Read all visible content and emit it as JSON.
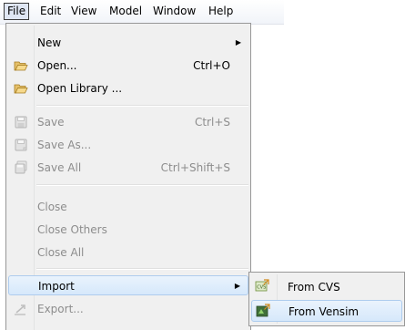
{
  "menubar": {
    "items": [
      "File",
      "Edit",
      "View",
      "Model",
      "Window",
      "Help"
    ]
  },
  "file_menu": {
    "new": {
      "label": "New"
    },
    "open": {
      "label": "Open...",
      "accel": "Ctrl+O",
      "icon": "open-folder-icon"
    },
    "open_library": {
      "label": "Open Library ...",
      "icon": "open-folder-icon"
    },
    "save": {
      "label": "Save",
      "accel": "Ctrl+S",
      "icon": "save-icon"
    },
    "save_as": {
      "label": "Save As...",
      "icon": "save-as-icon"
    },
    "save_all": {
      "label": "Save All",
      "accel": "Ctrl+Shift+S",
      "icon": "save-all-icon"
    },
    "close": {
      "label": "Close"
    },
    "close_others": {
      "label": "Close Others"
    },
    "close_all": {
      "label": "Close All"
    },
    "import": {
      "label": "Import"
    },
    "export": {
      "label": "Export...",
      "icon": "export-icon"
    }
  },
  "import_submenu": {
    "from_cvs": {
      "label": "From CVS",
      "icon": "cvs-import-icon"
    },
    "from_vensim": {
      "label": "From Vensim",
      "icon": "vensim-import-icon"
    }
  },
  "colors": {
    "menu_bg": "#f0f0f0",
    "highlight_border": "#aeccee",
    "disabled_text": "#8d8d8d"
  }
}
